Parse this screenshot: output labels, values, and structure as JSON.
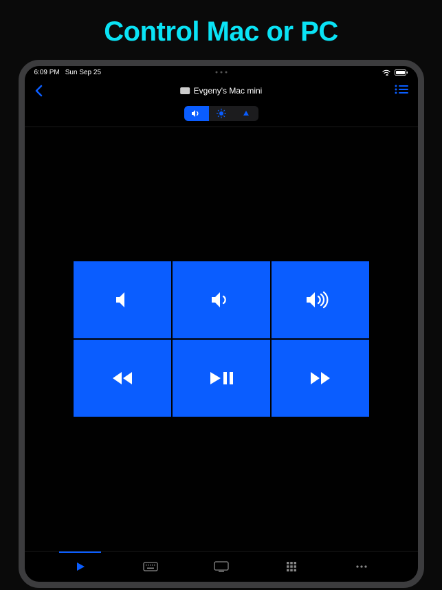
{
  "marketing": {
    "title": "Control Mac or PC"
  },
  "status": {
    "time": "6:09 PM",
    "date": "Sun Sep 25"
  },
  "nav": {
    "device_name": "Evgeny's Mac mini"
  },
  "segments": [
    {
      "name": "volume",
      "active": true
    },
    {
      "name": "brightness",
      "active": false
    },
    {
      "name": "navigation",
      "active": false
    }
  ],
  "pads": [
    {
      "name": "mute"
    },
    {
      "name": "volume-down"
    },
    {
      "name": "volume-up"
    },
    {
      "name": "rewind"
    },
    {
      "name": "play-pause"
    },
    {
      "name": "fast-forward"
    }
  ],
  "tabs": [
    {
      "name": "media",
      "active": true
    },
    {
      "name": "keyboard",
      "active": false
    },
    {
      "name": "display",
      "active": false
    },
    {
      "name": "grid",
      "active": false
    },
    {
      "name": "more",
      "active": false
    }
  ],
  "colors": {
    "accent": "#0a5dff",
    "title": "#0ae3f5"
  }
}
